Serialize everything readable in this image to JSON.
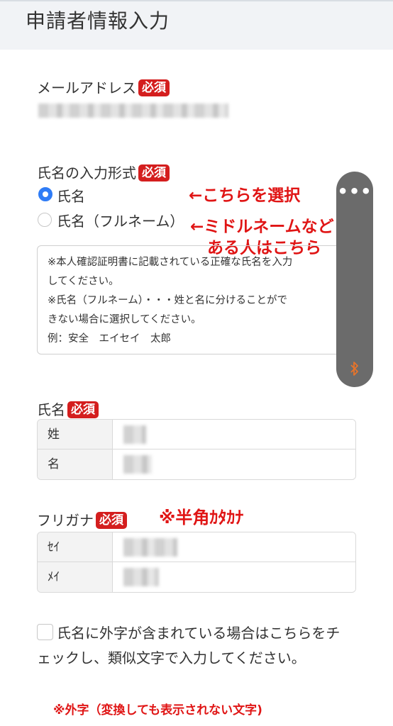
{
  "header": {
    "title": "申請者情報入力"
  },
  "required_badge": "必須",
  "email": {
    "label": "メールアドレス"
  },
  "name_format": {
    "label": "氏名の入力形式",
    "options": [
      {
        "label": "氏名",
        "selected": true
      },
      {
        "label": "氏名（フルネーム）",
        "selected": false
      }
    ]
  },
  "annotations": {
    "select_this": "←こちらを選択",
    "middle_name_line1": "←ミドルネームなど",
    "middle_name_line2": "ある人はこちら",
    "half_width_kana": "※半角ｶﾀｶﾅ"
  },
  "notice": {
    "lines": [
      "※本人確認証明書に記載されている正確な氏名を入力",
      "してください。",
      "※氏名（フルネーム）・・・姓と名に分けることがで",
      "きない場合に選択してください。",
      "例：安全　エイセイ　太郎"
    ]
  },
  "name": {
    "label": "氏名",
    "fields": [
      "姓",
      "名"
    ]
  },
  "furigana": {
    "label": "フリガナ",
    "fields": [
      "ｾｲ",
      "ﾒｲ"
    ]
  },
  "gaiji": {
    "checkbox_text": "氏名に外字が含まれている場合はこちらをチェックし、類似文字で入力してください。",
    "checked": false,
    "footnote": "※外字（変換しても表示されない文字)"
  },
  "floating_widget": {
    "menu_icon": "more-dots-icon",
    "bluetooth_icon": "bluetooth-icon",
    "menu_glyph": "•••"
  },
  "colors": {
    "required_badge": "#d41e1e",
    "annotation": "#e01515",
    "radio_selected": "#2f7cf6"
  }
}
